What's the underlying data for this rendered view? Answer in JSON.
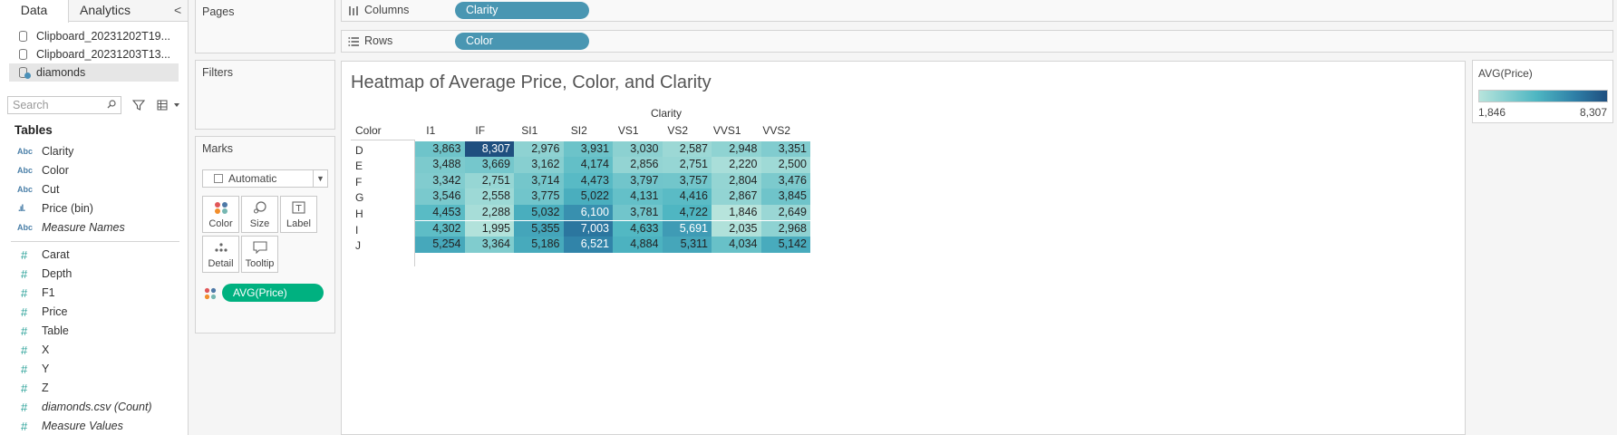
{
  "pane": {
    "tab_data": "Data",
    "tab_analytics": "Analytics",
    "collapse": "<"
  },
  "sources": [
    {
      "label": "Clipboard_20231202T19...",
      "active": false
    },
    {
      "label": "Clipboard_20231203T13...",
      "active": false
    },
    {
      "label": "diamonds",
      "active": true
    }
  ],
  "search": {
    "placeholder": "Search"
  },
  "tables_heading": "Tables",
  "dimensions": [
    {
      "type": "Abc",
      "label": "Clarity"
    },
    {
      "type": "Abc",
      "label": "Color"
    },
    {
      "type": "Abc",
      "label": "Cut"
    },
    {
      "type": "bin",
      "label": "Price (bin)"
    },
    {
      "type": "Abc",
      "label": "Measure Names"
    }
  ],
  "measures": [
    {
      "type": "#",
      "label": "Carat"
    },
    {
      "type": "#",
      "label": "Depth"
    },
    {
      "type": "#",
      "label": "F1"
    },
    {
      "type": "#",
      "label": "Price"
    },
    {
      "type": "#",
      "label": "Table"
    },
    {
      "type": "#",
      "label": "X"
    },
    {
      "type": "#",
      "label": "Y"
    },
    {
      "type": "#",
      "label": "Z"
    },
    {
      "type": "#",
      "label": "diamonds.csv (Count)"
    },
    {
      "type": "#",
      "label": "Measure Values"
    }
  ],
  "cards": {
    "pages": "Pages",
    "filters": "Filters",
    "marks": "Marks",
    "mark_type": "Automatic",
    "buttons": {
      "color": "Color",
      "size": "Size",
      "label": "Label",
      "detail": "Detail",
      "tooltip": "Tooltip"
    },
    "color_pill": "AVG(Price)"
  },
  "shelves": {
    "columns_label": "Columns",
    "columns_pill": "Clarity",
    "rows_label": "Rows",
    "rows_pill": "Color"
  },
  "view": {
    "title": "Heatmap of Average Price, Color, and Clarity"
  },
  "legend": {
    "title": "AVG(Price)",
    "min": "1,846",
    "max": "8,307",
    "colors": [
      "#b7e4dc",
      "#4eb6c2",
      "#2e7fa7",
      "#1f4f7f"
    ]
  },
  "chart_data": {
    "type": "heatmap",
    "title": "Heatmap of Average Price, Color, and Clarity",
    "xlabel": "Clarity",
    "ylabel": "Color",
    "x_categories": [
      "I1",
      "IF",
      "SI1",
      "SI2",
      "VS1",
      "VS2",
      "VVS1",
      "VVS2"
    ],
    "y_categories": [
      "D",
      "E",
      "F",
      "G",
      "H",
      "I",
      "J"
    ],
    "values": [
      [
        3863,
        8307,
        2976,
        3931,
        3030,
        2587,
        2948,
        3351
      ],
      [
        3488,
        3669,
        3162,
        4174,
        2856,
        2751,
        2220,
        2500
      ],
      [
        3342,
        2751,
        3714,
        4473,
        3797,
        3757,
        2804,
        3476
      ],
      [
        3546,
        2558,
        3775,
        5022,
        4131,
        4416,
        2867,
        3845
      ],
      [
        4453,
        2288,
        5032,
        6100,
        3781,
        4722,
        1846,
        2649
      ],
      [
        4302,
        1995,
        5355,
        7003,
        4633,
        5691,
        2035,
        2968
      ],
      [
        5254,
        3364,
        5186,
        6521,
        4884,
        5311,
        4034,
        5142
      ]
    ],
    "color_range": [
      1846,
      8307
    ]
  }
}
